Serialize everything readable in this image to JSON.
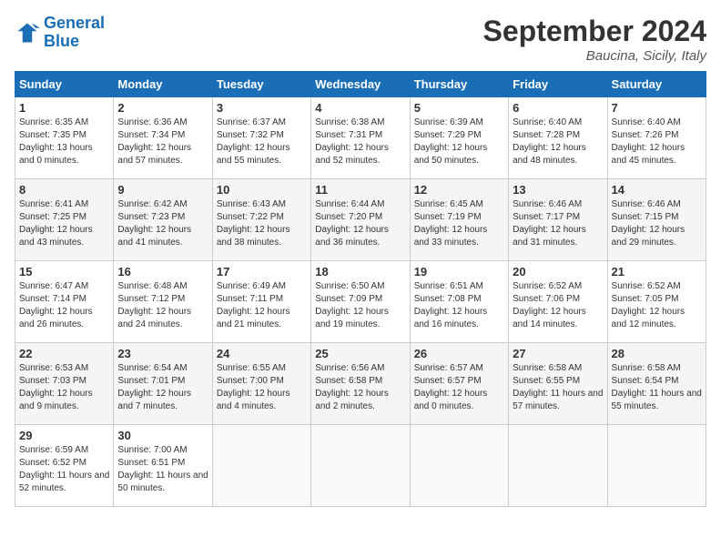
{
  "logo": {
    "line1": "General",
    "line2": "Blue"
  },
  "title": "September 2024",
  "location": "Baucina, Sicily, Italy",
  "headers": [
    "Sunday",
    "Monday",
    "Tuesday",
    "Wednesday",
    "Thursday",
    "Friday",
    "Saturday"
  ],
  "weeks": [
    [
      {
        "day": "1",
        "sunrise": "Sunrise: 6:35 AM",
        "sunset": "Sunset: 7:35 PM",
        "daylight": "Daylight: 13 hours and 0 minutes."
      },
      {
        "day": "2",
        "sunrise": "Sunrise: 6:36 AM",
        "sunset": "Sunset: 7:34 PM",
        "daylight": "Daylight: 12 hours and 57 minutes."
      },
      {
        "day": "3",
        "sunrise": "Sunrise: 6:37 AM",
        "sunset": "Sunset: 7:32 PM",
        "daylight": "Daylight: 12 hours and 55 minutes."
      },
      {
        "day": "4",
        "sunrise": "Sunrise: 6:38 AM",
        "sunset": "Sunset: 7:31 PM",
        "daylight": "Daylight: 12 hours and 52 minutes."
      },
      {
        "day": "5",
        "sunrise": "Sunrise: 6:39 AM",
        "sunset": "Sunset: 7:29 PM",
        "daylight": "Daylight: 12 hours and 50 minutes."
      },
      {
        "day": "6",
        "sunrise": "Sunrise: 6:40 AM",
        "sunset": "Sunset: 7:28 PM",
        "daylight": "Daylight: 12 hours and 48 minutes."
      },
      {
        "day": "7",
        "sunrise": "Sunrise: 6:40 AM",
        "sunset": "Sunset: 7:26 PM",
        "daylight": "Daylight: 12 hours and 45 minutes."
      }
    ],
    [
      {
        "day": "8",
        "sunrise": "Sunrise: 6:41 AM",
        "sunset": "Sunset: 7:25 PM",
        "daylight": "Daylight: 12 hours and 43 minutes."
      },
      {
        "day": "9",
        "sunrise": "Sunrise: 6:42 AM",
        "sunset": "Sunset: 7:23 PM",
        "daylight": "Daylight: 12 hours and 41 minutes."
      },
      {
        "day": "10",
        "sunrise": "Sunrise: 6:43 AM",
        "sunset": "Sunset: 7:22 PM",
        "daylight": "Daylight: 12 hours and 38 minutes."
      },
      {
        "day": "11",
        "sunrise": "Sunrise: 6:44 AM",
        "sunset": "Sunset: 7:20 PM",
        "daylight": "Daylight: 12 hours and 36 minutes."
      },
      {
        "day": "12",
        "sunrise": "Sunrise: 6:45 AM",
        "sunset": "Sunset: 7:19 PM",
        "daylight": "Daylight: 12 hours and 33 minutes."
      },
      {
        "day": "13",
        "sunrise": "Sunrise: 6:46 AM",
        "sunset": "Sunset: 7:17 PM",
        "daylight": "Daylight: 12 hours and 31 minutes."
      },
      {
        "day": "14",
        "sunrise": "Sunrise: 6:46 AM",
        "sunset": "Sunset: 7:15 PM",
        "daylight": "Daylight: 12 hours and 29 minutes."
      }
    ],
    [
      {
        "day": "15",
        "sunrise": "Sunrise: 6:47 AM",
        "sunset": "Sunset: 7:14 PM",
        "daylight": "Daylight: 12 hours and 26 minutes."
      },
      {
        "day": "16",
        "sunrise": "Sunrise: 6:48 AM",
        "sunset": "Sunset: 7:12 PM",
        "daylight": "Daylight: 12 hours and 24 minutes."
      },
      {
        "day": "17",
        "sunrise": "Sunrise: 6:49 AM",
        "sunset": "Sunset: 7:11 PM",
        "daylight": "Daylight: 12 hours and 21 minutes."
      },
      {
        "day": "18",
        "sunrise": "Sunrise: 6:50 AM",
        "sunset": "Sunset: 7:09 PM",
        "daylight": "Daylight: 12 hours and 19 minutes."
      },
      {
        "day": "19",
        "sunrise": "Sunrise: 6:51 AM",
        "sunset": "Sunset: 7:08 PM",
        "daylight": "Daylight: 12 hours and 16 minutes."
      },
      {
        "day": "20",
        "sunrise": "Sunrise: 6:52 AM",
        "sunset": "Sunset: 7:06 PM",
        "daylight": "Daylight: 12 hours and 14 minutes."
      },
      {
        "day": "21",
        "sunrise": "Sunrise: 6:52 AM",
        "sunset": "Sunset: 7:05 PM",
        "daylight": "Daylight: 12 hours and 12 minutes."
      }
    ],
    [
      {
        "day": "22",
        "sunrise": "Sunrise: 6:53 AM",
        "sunset": "Sunset: 7:03 PM",
        "daylight": "Daylight: 12 hours and 9 minutes."
      },
      {
        "day": "23",
        "sunrise": "Sunrise: 6:54 AM",
        "sunset": "Sunset: 7:01 PM",
        "daylight": "Daylight: 12 hours and 7 minutes."
      },
      {
        "day": "24",
        "sunrise": "Sunrise: 6:55 AM",
        "sunset": "Sunset: 7:00 PM",
        "daylight": "Daylight: 12 hours and 4 minutes."
      },
      {
        "day": "25",
        "sunrise": "Sunrise: 6:56 AM",
        "sunset": "Sunset: 6:58 PM",
        "daylight": "Daylight: 12 hours and 2 minutes."
      },
      {
        "day": "26",
        "sunrise": "Sunrise: 6:57 AM",
        "sunset": "Sunset: 6:57 PM",
        "daylight": "Daylight: 12 hours and 0 minutes."
      },
      {
        "day": "27",
        "sunrise": "Sunrise: 6:58 AM",
        "sunset": "Sunset: 6:55 PM",
        "daylight": "Daylight: 11 hours and 57 minutes."
      },
      {
        "day": "28",
        "sunrise": "Sunrise: 6:58 AM",
        "sunset": "Sunset: 6:54 PM",
        "daylight": "Daylight: 11 hours and 55 minutes."
      }
    ],
    [
      {
        "day": "29",
        "sunrise": "Sunrise: 6:59 AM",
        "sunset": "Sunset: 6:52 PM",
        "daylight": "Daylight: 11 hours and 52 minutes."
      },
      {
        "day": "30",
        "sunrise": "Sunrise: 7:00 AM",
        "sunset": "Sunset: 6:51 PM",
        "daylight": "Daylight: 11 hours and 50 minutes."
      },
      null,
      null,
      null,
      null,
      null
    ]
  ]
}
